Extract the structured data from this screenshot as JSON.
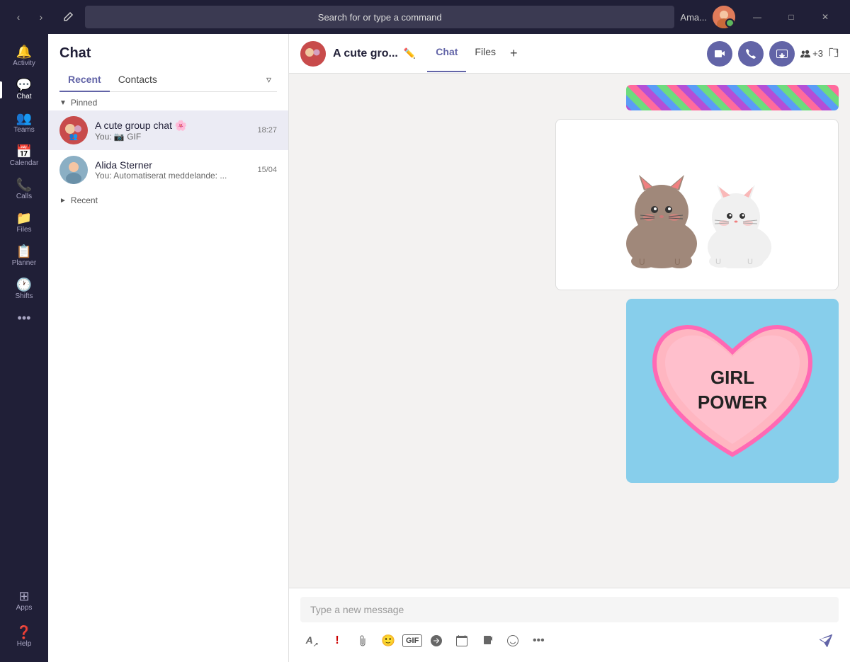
{
  "titlebar": {
    "search_placeholder": "Search for or type a command",
    "user_name": "Ama...",
    "nav_back": "‹",
    "nav_forward": "›"
  },
  "sidebar": {
    "items": [
      {
        "id": "activity",
        "label": "Activity",
        "icon": "🔔"
      },
      {
        "id": "chat",
        "label": "Chat",
        "icon": "💬"
      },
      {
        "id": "teams",
        "label": "Teams",
        "icon": "👥"
      },
      {
        "id": "calendar",
        "label": "Calendar",
        "icon": "📅"
      },
      {
        "id": "calls",
        "label": "Calls",
        "icon": "📞"
      },
      {
        "id": "files",
        "label": "Files",
        "icon": "📁"
      },
      {
        "id": "planner",
        "label": "Planner",
        "icon": "📋"
      },
      {
        "id": "shifts",
        "label": "Shifts",
        "icon": "🕐"
      }
    ],
    "more_label": "•••",
    "apps_label": "Apps",
    "help_label": "Help"
  },
  "chat_panel": {
    "title": "Chat",
    "tabs": [
      {
        "id": "recent",
        "label": "Recent",
        "active": true
      },
      {
        "id": "contacts",
        "label": "Contacts",
        "active": false
      }
    ],
    "pinned_label": "Pinned",
    "recent_label": "Recent",
    "conversations": [
      {
        "id": "group1",
        "name": "A cute group chat 🌸",
        "preview": "You: 📷 GIF",
        "time": "18:27",
        "active": true,
        "is_group": true
      },
      {
        "id": "alida",
        "name": "Alida Sterner",
        "preview": "You: Automatiserat meddelande: ...",
        "time": "15/04",
        "active": false,
        "is_group": false
      }
    ]
  },
  "content": {
    "header": {
      "title": "A cute gro...",
      "tabs": [
        {
          "id": "chat",
          "label": "Chat",
          "active": true
        },
        {
          "id": "files",
          "label": "Files",
          "active": false
        }
      ],
      "participants_count": "+3",
      "add_label": "+"
    },
    "messages": {
      "girlpower_text": "GIRL\nPOWER"
    },
    "input": {
      "placeholder": "Type a new message"
    },
    "toolbar": {
      "format": "A",
      "exclaim": "!",
      "attach": "📎",
      "emoji": "😊",
      "gif": "GIF",
      "sticker": "🎭",
      "meeting": "📅",
      "loop": "↺",
      "praise": "🏅",
      "more": "•••"
    }
  }
}
